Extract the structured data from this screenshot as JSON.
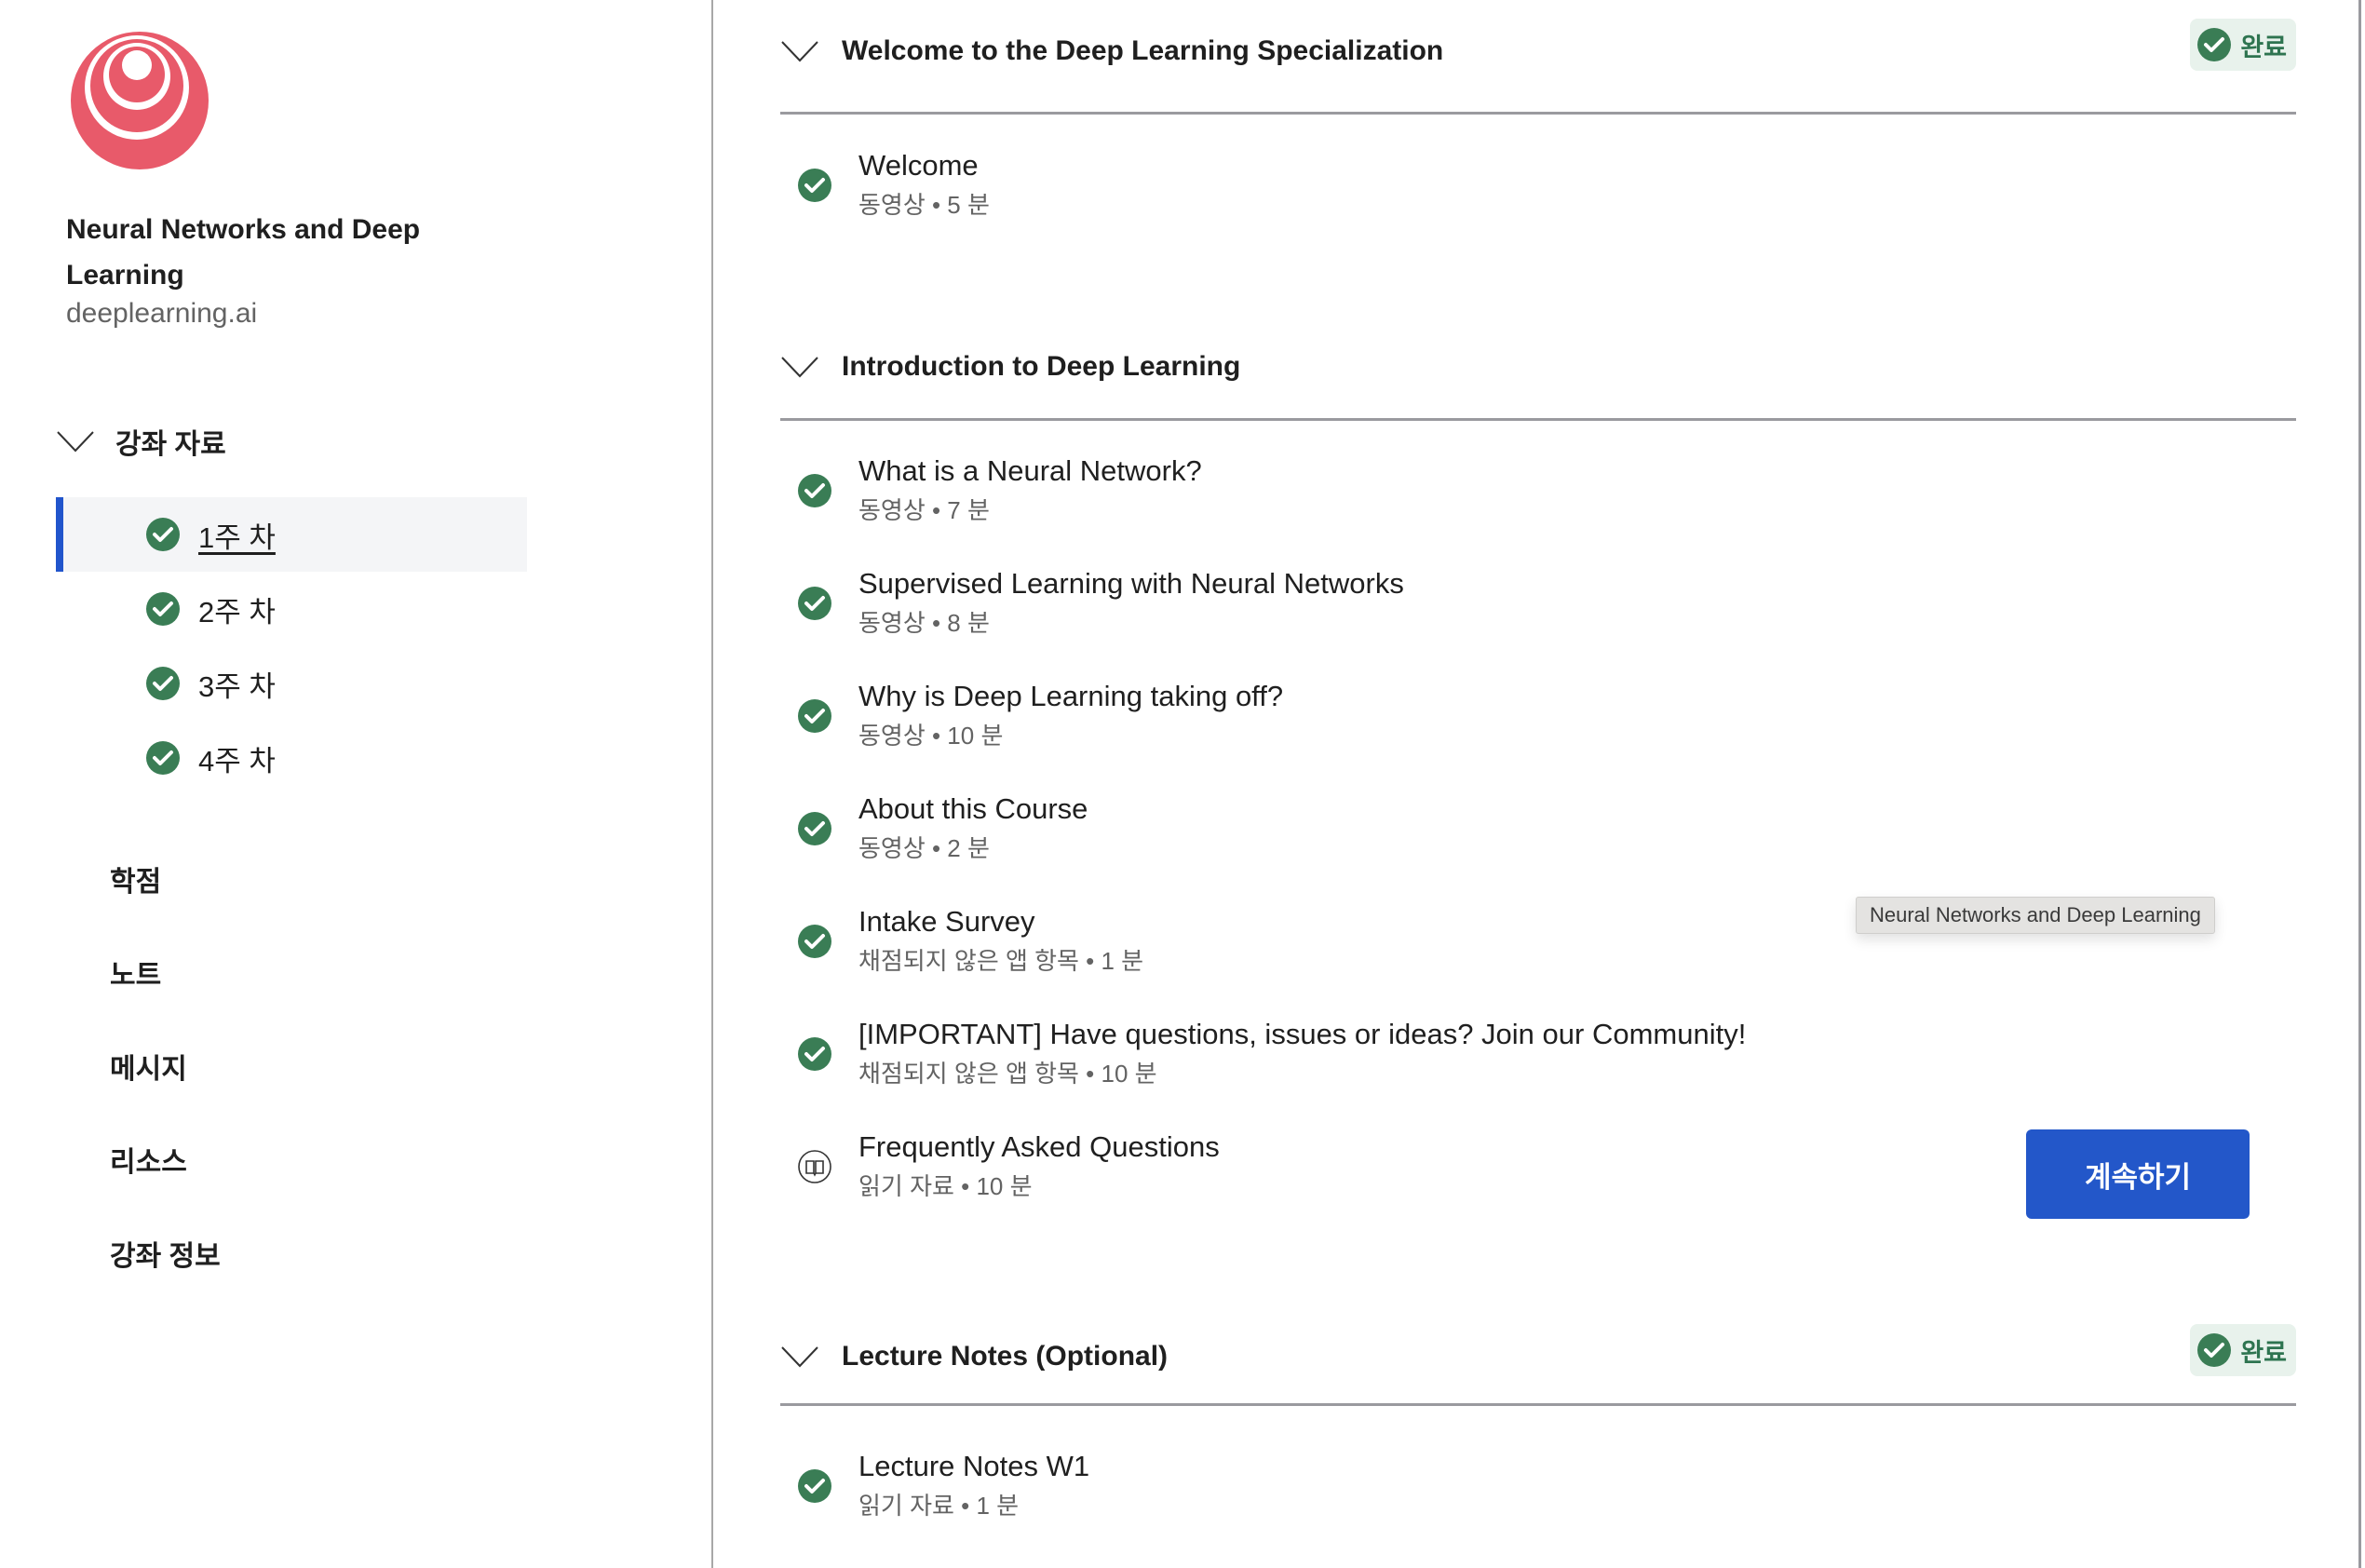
{
  "course": {
    "title": "Neural Networks and Deep Learning",
    "org": "deeplearning.ai",
    "logo_color": "#e85a6a"
  },
  "sidebar": {
    "materials_label": "강좌 자료",
    "weeks": [
      {
        "label": "1주 차",
        "completed": true,
        "active": true
      },
      {
        "label": "2주 차",
        "completed": true,
        "active": false
      },
      {
        "label": "3주 차",
        "completed": true,
        "active": false
      },
      {
        "label": "4주 차",
        "completed": true,
        "active": false
      }
    ],
    "links": [
      {
        "label": "학점"
      },
      {
        "label": "노트"
      },
      {
        "label": "메시지"
      },
      {
        "label": "리소스"
      },
      {
        "label": "강좌 정보"
      }
    ]
  },
  "colors": {
    "accent": "#2155cc",
    "complete_green": "#3a7d55",
    "badge_bg": "#e8f2ec"
  },
  "sections": [
    {
      "title": "Welcome to the Deep Learning Specialization",
      "badge": "완료",
      "items": [
        {
          "name": "Welcome",
          "meta": "동영상 • 5 분",
          "status": "completed"
        }
      ]
    },
    {
      "title": "Introduction to Deep Learning",
      "badge": null,
      "items": [
        {
          "name": "What is a Neural Network?",
          "meta": "동영상 • 7 분",
          "status": "completed"
        },
        {
          "name": "Supervised Learning with Neural Networks",
          "meta": "동영상 • 8 분",
          "status": "completed"
        },
        {
          "name": "Why is Deep Learning taking off?",
          "meta": "동영상 • 10 분",
          "status": "completed"
        },
        {
          "name": "About this Course",
          "meta": "동영상 • 2 분",
          "status": "completed"
        },
        {
          "name": "Intake Survey",
          "meta": "채점되지 않은 앱 항목 • 1 분",
          "status": "completed"
        },
        {
          "name": "[IMPORTANT] Have questions, issues or ideas? Join our Community!",
          "meta": "채점되지 않은 앱 항목 • 10 분",
          "status": "completed"
        },
        {
          "name": "Frequently Asked Questions",
          "meta": "읽기 자료 • 10 분",
          "status": "reading"
        }
      ]
    },
    {
      "title": "Lecture Notes (Optional)",
      "badge": "완료",
      "items": [
        {
          "name": "Lecture Notes W1",
          "meta": "읽기 자료 • 1 분",
          "status": "completed"
        }
      ]
    }
  ],
  "continue_button": "계속하기",
  "tooltip": "Neural Networks and Deep Learning"
}
